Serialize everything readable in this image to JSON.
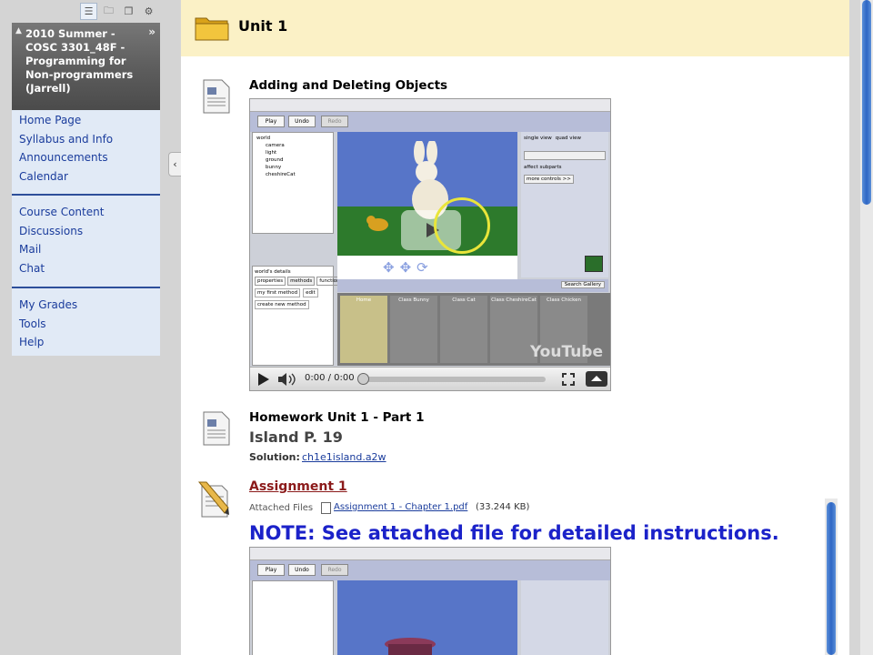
{
  "leftbar": {
    "course_title": "2010 Summer - COSC 3301_48F - Programming for Non-programmers (Jarrell)",
    "menu_group_1": [
      "Home Page",
      "Syllabus and Info",
      "Announcements",
      "Calendar"
    ],
    "menu_group_2": [
      "Course Content",
      "Discussions",
      "Mail",
      "Chat"
    ],
    "menu_group_3": [
      "My Grades",
      "Tools",
      "Help"
    ]
  },
  "main": {
    "unit_title": "Unit 1",
    "item1_title": "Adding and Deleting Objects",
    "video": {
      "time": "0:00 / 0:00",
      "watermark": "YouTube",
      "gallery_items": [
        "Home",
        "Class Bunny",
        "Class Cat",
        "Class CheshireCat",
        "Class Chicken"
      ],
      "tree_items": [
        "world",
        "camera",
        "light",
        "ground",
        "bunny",
        "cheshireCat"
      ],
      "details_title": "world's details",
      "details_tabs": [
        "properties",
        "methods",
        "functions"
      ],
      "method_label": "my first method",
      "edit_label": "edit",
      "create_label": "create new method",
      "search_label": "Search Gallery",
      "more_controls": "more controls >>",
      "view_single": "single view",
      "view_quad": "quad view",
      "affect_subparts": "affect subparts",
      "toolbar_play": "Play",
      "toolbar_undo": "Undo",
      "toolbar_redo": "Redo"
    },
    "item2_title": "Homework Unit 1 - Part 1",
    "item2_subhead": "Island P. 19",
    "solution_label": "Solution:",
    "solution_link": "ch1e1island.a2w",
    "assignment_link": "Assignment 1",
    "attached_label": "Attached Files",
    "attached_file": "Assignment 1 - Chapter 1.pdf",
    "attached_size": "(33.244 KB)",
    "note": "NOTE: See attached file for detailed instructions."
  },
  "colors": {
    "header_bg": "#fbf1c6",
    "menu_bg": "#e1eaf6",
    "link": "#1a3c9c",
    "note": "#1b22c9",
    "assignment": "#8b1a1a"
  }
}
